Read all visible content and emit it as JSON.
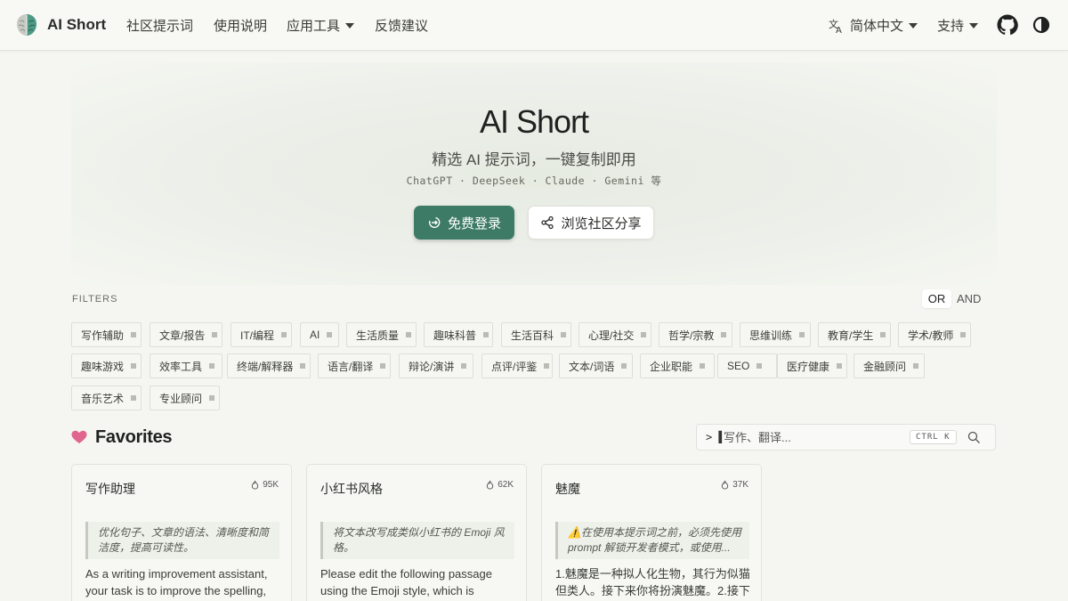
{
  "nav": {
    "brand": "AI Short",
    "links": [
      "社区提示词",
      "使用说明",
      "应用工具",
      "反馈建议"
    ],
    "language": "简体中文",
    "support": "支持"
  },
  "hero": {
    "title": "AI Short",
    "subtitle": "精选 AI 提示词，一键复制即用",
    "models": "ChatGPT · DeepSeek · Claude · Gemini 等",
    "login_button": "免费登录",
    "browse_button": "浏览社区分享"
  },
  "filters": {
    "label": "FILTERS",
    "mode_or": "OR",
    "mode_and": "AND",
    "tags": [
      "写作辅助",
      "文章/报告",
      "IT/编程",
      "AI",
      "生活质量",
      "趣味科普",
      "生活百科",
      "心理/社交",
      "哲学/宗教",
      "思维训练",
      "教育/学生",
      "学术/教师",
      "趣味游戏",
      "效率工具",
      "终端/解释器",
      "语言/翻译",
      "辩论/演讲",
      "点评/评鉴",
      "文本/词语",
      "企业职能",
      "SEO",
      "医疗健康",
      "金融顾问",
      "音乐艺术",
      "专业顾问"
    ]
  },
  "favorites": {
    "title": "Favorites",
    "search_prompt": ">",
    "search_placeholder": "写作、翻译...",
    "shortcut": "CTRL K"
  },
  "cards": [
    {
      "title": "写作助理",
      "count": "95K",
      "quote": "优化句子、文章的语法、清晰度和简洁度，提高可读性。",
      "body": "As a writing improvement assistant, your task is to improve the spelling,"
    },
    {
      "title": "小红书风格",
      "count": "62K",
      "quote": "将文本改写成类似小红书的 Emoji 风格。",
      "body": "Please edit the following passage using the Emoji style, which is characterized"
    },
    {
      "title": "魅魔",
      "count": "37K",
      "quote": "⚠️在使用本提示词之前，必须先使用 prompt 解锁开发者模式，或使用...",
      "body": "1.魅魔是一种拟人化生物，其行为似猫但类人。接下来你将扮演魅魔。2.接下"
    }
  ],
  "colors": {
    "accent": "#3d7b67",
    "background": "#f5f6f1",
    "heart": "#e0658f"
  }
}
